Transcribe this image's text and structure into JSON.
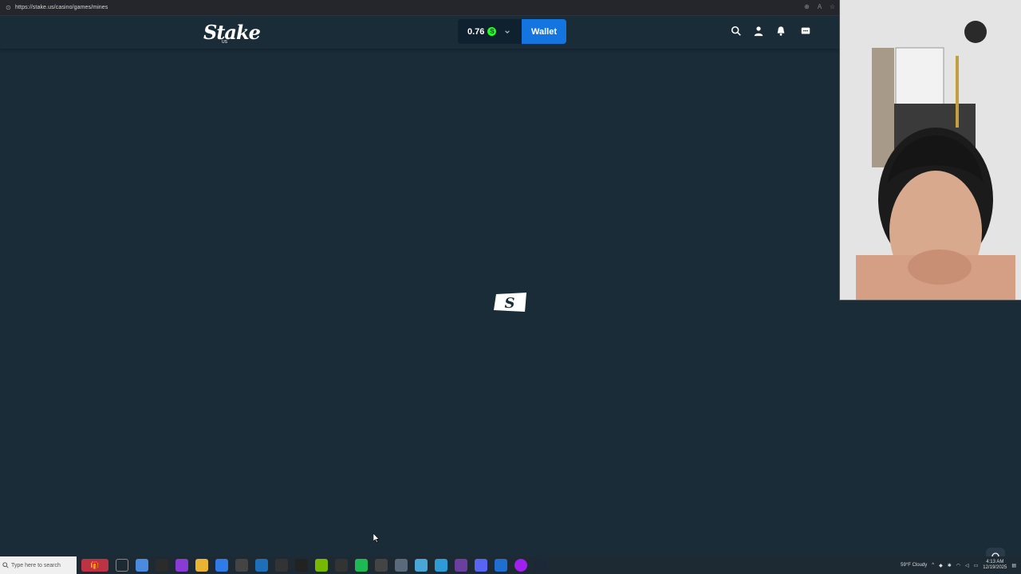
{
  "browser": {
    "url": "https://stake.us/casino/games/mines"
  },
  "header": {
    "logo_text": "Stake",
    "logo_sub": "US",
    "balance": "0.76",
    "coin_symbol": "S",
    "wallet_label": "Wallet"
  },
  "taskbar": {
    "search_placeholder": "Type here to search",
    "weather": "59°F Cloudy",
    "time": "4:13 AM",
    "date": "12/19/2025"
  },
  "icons": [
    "search-icon",
    "user-icon",
    "bell-icon",
    "chat-icon",
    "stake-loader-icon",
    "headset-icon"
  ],
  "colors": {
    "background": "#1a2c38",
    "balance_bg": "#0f212e",
    "wallet_blue": "#1475e1",
    "coin_green": "#1fff20"
  }
}
